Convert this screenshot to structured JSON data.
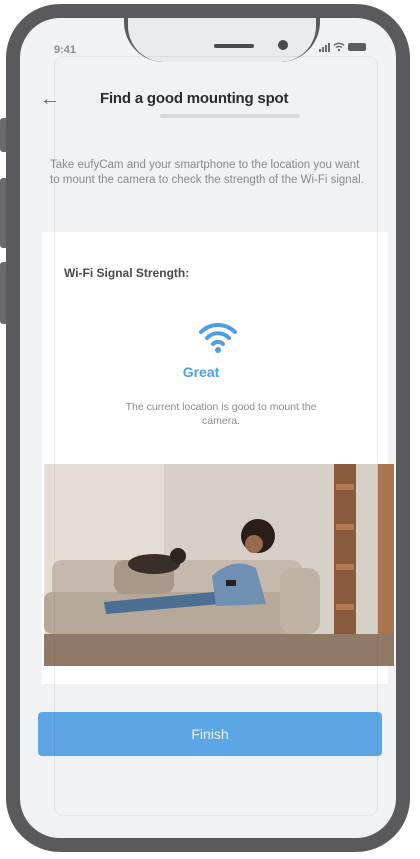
{
  "status_bar": {
    "time": "9:41"
  },
  "header": {
    "back_icon": "back-arrow-icon",
    "title": "Find a good mounting spot"
  },
  "instructions": {
    "text": "Take eufyCam and your smartphone to the location you want to mount the camera to check the strength of the Wi-Fi signal."
  },
  "signal_card": {
    "title": "Wi-Fi Signal Strength:",
    "icon": "wifi-icon",
    "status": "Great",
    "status_color": "#4e9ee0",
    "message": "The current location is good to mount the camera."
  },
  "finish_button": {
    "label": "Finish",
    "color": "#5ca6e6"
  },
  "colors": {
    "frame": "#5a5a5c",
    "screen_bg": "#f1f2f4",
    "card_bg": "#ffffff"
  }
}
